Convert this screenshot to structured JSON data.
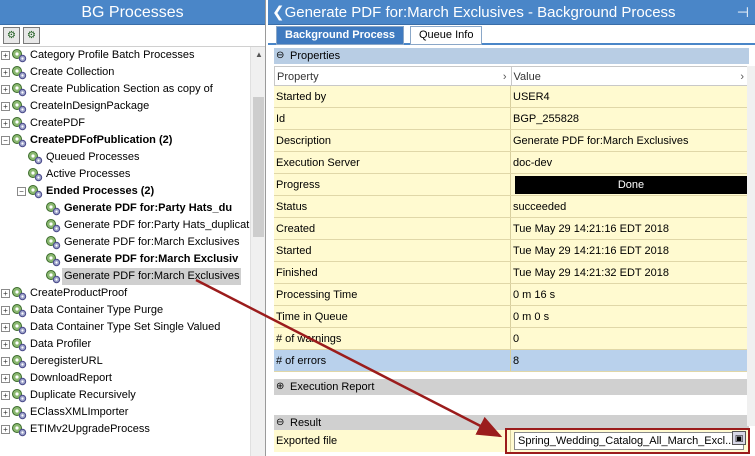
{
  "left_panel": {
    "title": "BG Processes",
    "toolbar": [
      {
        "name": "expand-all-icon",
        "glyph": "⚙"
      },
      {
        "name": "collapse-all-icon",
        "glyph": "⚙"
      }
    ],
    "tree": [
      {
        "label": "Category Profile Batch Processes",
        "level": 0,
        "expander": "+",
        "bold": false
      },
      {
        "label": "Create Collection",
        "level": 0,
        "expander": "+",
        "bold": false
      },
      {
        "label": "Create Publication Section as copy of",
        "level": 0,
        "expander": "+",
        "bold": false
      },
      {
        "label": "CreateInDesignPackage",
        "level": 0,
        "expander": "+",
        "bold": false
      },
      {
        "label": "CreatePDF",
        "level": 0,
        "expander": "+",
        "bold": false
      },
      {
        "label": "CreatePDFofPublication (2)",
        "level": 0,
        "expander": "-",
        "bold": true
      },
      {
        "label": "Queued Processes",
        "level": 1,
        "expander": "",
        "bold": false
      },
      {
        "label": "Active Processes",
        "level": 1,
        "expander": "",
        "bold": false
      },
      {
        "label": "Ended Processes (2)",
        "level": 1,
        "expander": "-",
        "bold": true
      },
      {
        "label": "Generate PDF for:Party Hats_du",
        "level": 2,
        "expander": "",
        "bold": true
      },
      {
        "label": "Generate PDF for:Party Hats_duplicat",
        "level": 2,
        "expander": "",
        "bold": false
      },
      {
        "label": "Generate PDF for:March Exclusives",
        "level": 2,
        "expander": "",
        "bold": false
      },
      {
        "label": "Generate PDF for:March Exclusiv",
        "level": 2,
        "expander": "",
        "bold": true
      },
      {
        "label": "Generate PDF for:March Exclusives",
        "level": 2,
        "expander": "",
        "bold": false,
        "selected": true
      },
      {
        "label": "CreateProductProof",
        "level": 0,
        "expander": "+",
        "bold": false
      },
      {
        "label": "Data Container Type Purge",
        "level": 0,
        "expander": "+",
        "bold": false
      },
      {
        "label": "Data Container Type Set Single Valued",
        "level": 0,
        "expander": "+",
        "bold": false
      },
      {
        "label": "Data Profiler",
        "level": 0,
        "expander": "+",
        "bold": false
      },
      {
        "label": "DeregisterURL",
        "level": 0,
        "expander": "+",
        "bold": false
      },
      {
        "label": "DownloadReport",
        "level": 0,
        "expander": "+",
        "bold": false
      },
      {
        "label": "Duplicate Recursively",
        "level": 0,
        "expander": "+",
        "bold": false
      },
      {
        "label": "EClassXMLImporter",
        "level": 0,
        "expander": "+",
        "bold": false
      },
      {
        "label": "ETIMv2UpgradeProcess",
        "level": 0,
        "expander": "+",
        "bold": false
      }
    ]
  },
  "right_panel": {
    "title": "Generate PDF for:March Exclusives - Background Process",
    "back_glyph": "❮",
    "pin_glyph": "⊣",
    "tabs": [
      {
        "label": "Background Process",
        "active": true
      },
      {
        "label": "Queue Info",
        "active": false
      }
    ],
    "properties_header": "Properties",
    "grid_headers": {
      "property": "Property",
      "value": "Value"
    },
    "rows": [
      {
        "key": "Started by",
        "value": "USER4"
      },
      {
        "key": "Id",
        "value": "BGP_255828"
      },
      {
        "key": "Description",
        "value": "Generate PDF for:March Exclusives"
      },
      {
        "key": "Execution Server",
        "value": "doc-dev"
      },
      {
        "key": "Progress",
        "value": "Done",
        "progress": 1.0
      },
      {
        "key": "Status",
        "value": "succeeded"
      },
      {
        "key": "Created",
        "value": "Tue May 29 14:21:16 EDT 2018"
      },
      {
        "key": "Started",
        "value": "Tue May 29 14:21:16 EDT 2018"
      },
      {
        "key": "Finished",
        "value": "Tue May 29 14:21:32 EDT 2018"
      },
      {
        "key": "Processing Time",
        "value": "0 m 16 s"
      },
      {
        "key": "Time in Queue",
        "value": "0 m 0 s"
      },
      {
        "key": "# of warnings",
        "value": "0"
      },
      {
        "key": "# of errors",
        "value": "8",
        "highlight": true
      }
    ],
    "execution_report_header": "Execution Report",
    "result_header": "Result",
    "exported_file": {
      "label": "Exported file",
      "value": "Spring_Wedding_Catalog_All_March_Excl..."
    }
  },
  "colors": {
    "title_bar": "#4a86c8",
    "annotation": "#9b1c1c"
  }
}
